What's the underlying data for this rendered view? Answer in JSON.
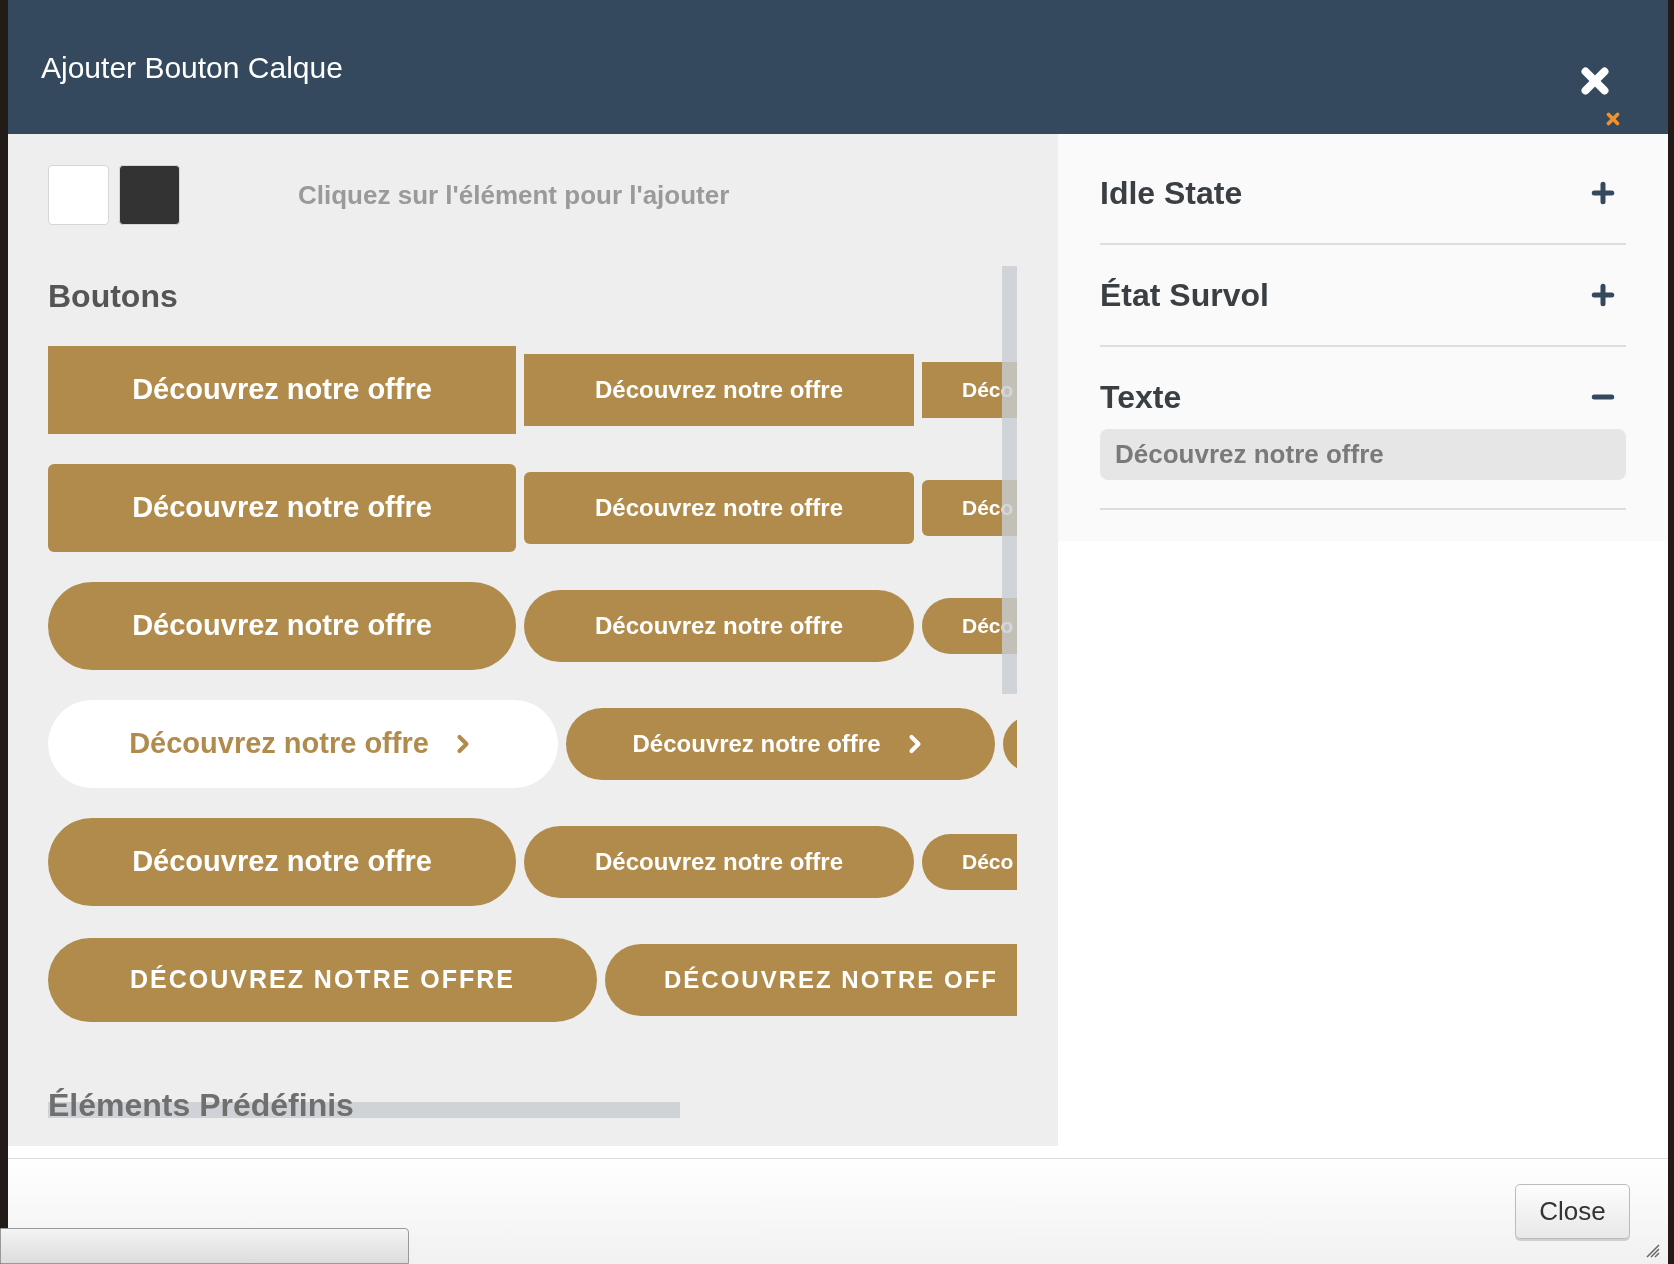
{
  "dialog": {
    "title": "Ajouter Bouton Calque"
  },
  "swatches": [
    {
      "color": "#ffffff"
    },
    {
      "color": "#333333"
    }
  ],
  "hint": "Cliquez sur l'élément pour l'ajouter",
  "buttons_section": {
    "title": "Boutons",
    "rows": [
      {
        "kind": "square",
        "items": [
          {
            "kind": "plain",
            "text": "Découvrez notre offre"
          },
          {
            "kind": "plain",
            "text": "Découvrez notre offre"
          },
          {
            "kind": "plain",
            "text": "Déco"
          }
        ]
      },
      {
        "kind": "rounded",
        "items": [
          {
            "kind": "plain",
            "text": "Découvrez notre offre"
          },
          {
            "kind": "plain",
            "text": "Découvrez notre offre"
          },
          {
            "kind": "plain",
            "text": "Déco"
          }
        ]
      },
      {
        "kind": "pill",
        "items": [
          {
            "kind": "plain",
            "text": "Découvrez notre offre"
          },
          {
            "kind": "plain",
            "text": "Découvrez notre offre"
          },
          {
            "kind": "plain",
            "text": "Déco"
          }
        ]
      },
      {
        "kind": "pill",
        "items": [
          {
            "kind": "inverted",
            "text": "Découvrez notre offre"
          },
          {
            "kind": "arrow",
            "text": "Découvrez notre offre"
          },
          {
            "kind": "plain"
          }
        ]
      },
      {
        "kind": "pill",
        "items": [
          {
            "kind": "plain",
            "text": "Découvrez notre offre"
          },
          {
            "kind": "plain",
            "text": "Découvrez notre offre"
          },
          {
            "kind": "plain",
            "text": "Déco"
          }
        ]
      },
      {
        "kind": "caps",
        "items": [
          {
            "kind": "plain",
            "text": "DÉCOUVREZ NOTRE OFFRE"
          },
          {
            "kind": "plain",
            "text": "DÉCOUVREZ NOTRE OFF"
          }
        ]
      }
    ]
  },
  "predefined_section": {
    "title": "Éléments Prédéfinis"
  },
  "accordion": [
    {
      "title": "Idle State",
      "expanded": false
    },
    {
      "title": "État Survol",
      "expanded": false
    },
    {
      "title": "Texte",
      "expanded": true,
      "field": {
        "value": "Découvrez notre offre"
      }
    }
  ],
  "footer": {
    "close_button": "Close"
  }
}
